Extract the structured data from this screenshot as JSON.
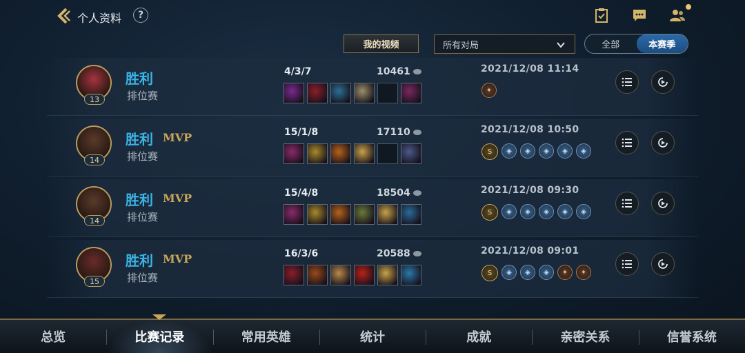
{
  "header": {
    "title": "个人资料",
    "help_label": "?"
  },
  "filters": {
    "my_videos": "我的视频",
    "match_select": "所有对局",
    "segment": [
      "全部",
      "本赛季"
    ],
    "segment_active": 1
  },
  "matches": [
    {
      "result": "胜利",
      "mvp": "",
      "mode": "排位赛",
      "level": "13",
      "kda": "4/3/7",
      "score": "10461",
      "datetime": "2021/12/08 11:14",
      "items": [
        "#7a2a8f",
        "#8b1f2a",
        "#2c6f94",
        "#9a8f6a",
        "",
        "#7a2860"
      ],
      "badges": [
        "copper"
      ]
    },
    {
      "result": "胜利",
      "mvp": "MVP",
      "mode": "排位赛",
      "level": "14",
      "kda": "15/1/8",
      "score": "17110",
      "datetime": "2021/12/08 10:50",
      "items": [
        "#8a2a6a",
        "#a88a2a",
        "#b8621a",
        "#c8a24a",
        "",
        "#4a5a8a"
      ],
      "badges": [
        "gold",
        "blue",
        "blue",
        "blue",
        "blue",
        "blue"
      ]
    },
    {
      "result": "胜利",
      "mvp": "MVP",
      "mode": "排位赛",
      "level": "14",
      "kda": "15/4/8",
      "score": "18504",
      "datetime": "2021/12/08 09:30",
      "items": [
        "#8a2a6a",
        "#a88a2a",
        "#b8621a",
        "#6a7a3a",
        "#c8a24a",
        "#2a6a9a"
      ],
      "badges": [
        "gold",
        "blue",
        "blue",
        "blue",
        "blue",
        "blue"
      ]
    },
    {
      "result": "胜利",
      "mvp": "MVP",
      "mode": "排位赛",
      "level": "15",
      "kda": "16/3/6",
      "score": "20588",
      "datetime": "2021/12/08 09:01",
      "items": [
        "#8a1f2a",
        "#9a4a1a",
        "#b88a4a",
        "#b8221a",
        "#c8a24a",
        "#2a7aaa"
      ],
      "badges": [
        "gold",
        "blue",
        "blue",
        "blue",
        "copper",
        "copper"
      ]
    }
  ],
  "nav": [
    "总览",
    "比赛记录",
    "常用英雄",
    "统计",
    "成就",
    "亲密关系",
    "信誉系统"
  ],
  "nav_active": 1,
  "colors": {
    "win": "#3bb4e8",
    "mvp": "#c9a75a",
    "accent_gold": "#c9a75a",
    "segment_active": "#2a6aa8"
  }
}
